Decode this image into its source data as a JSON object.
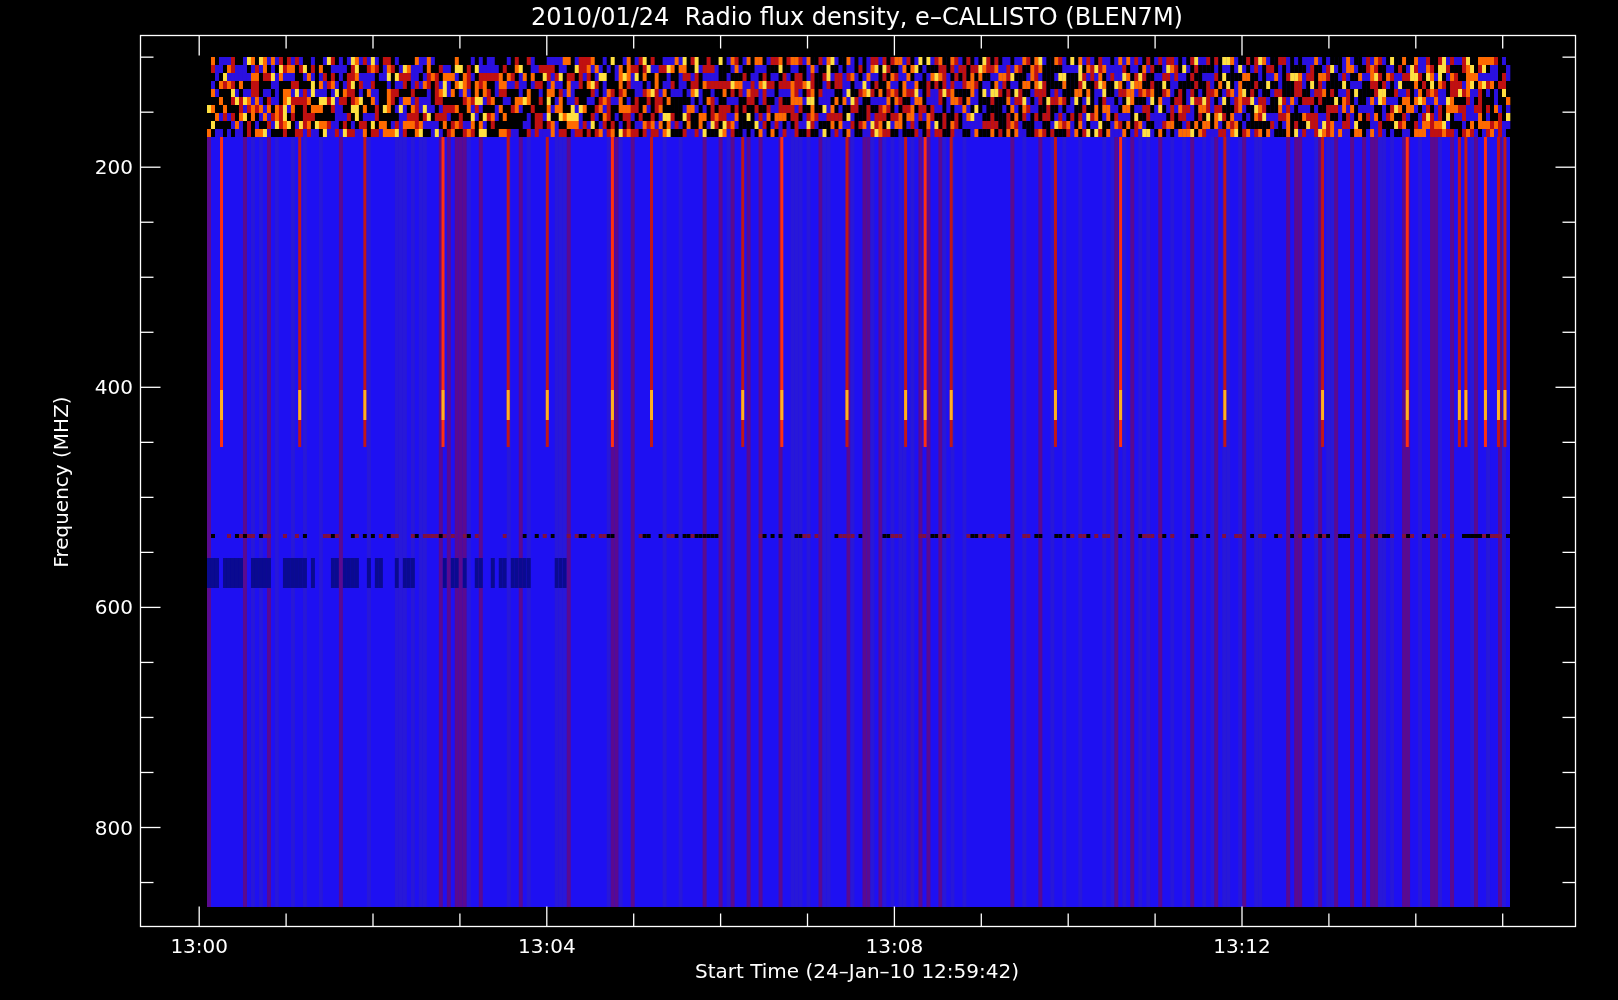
{
  "title": "2010/01/24  Radio flux density, e–CALLISTO (BLEN7M)",
  "plot": {
    "ylabel": "Frequency (MHZ)",
    "xlabel": "Start Time (24–Jan–10 12:59:42)",
    "yticks": [
      "200",
      "400",
      "600",
      "800"
    ],
    "xticks": [
      "13:00",
      "13:04",
      "13:08",
      "13:12"
    ]
  }
}
